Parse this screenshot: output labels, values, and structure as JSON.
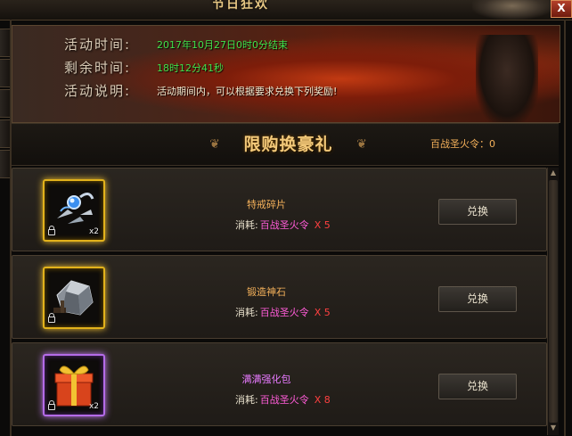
{
  "window": {
    "title": "节日狂欢",
    "close_label": "X"
  },
  "banner": {
    "rows": [
      {
        "label": "活动时间:",
        "value": "2017年10月27日0时0分结束"
      },
      {
        "label": "剩余时间:",
        "value": "18时12分41秒"
      },
      {
        "label": "活动说明:",
        "value": "活动期间内，可以根据要求兑换下列奖励!"
      }
    ]
  },
  "header": {
    "title": "限购换豪礼",
    "token_count": "百战圣火令：0"
  },
  "items": [
    {
      "name": "特戒碎片",
      "icon": "ring-fragment-icon",
      "quantity": "x2",
      "cost_label": "消耗:",
      "cost_token": "百战圣火令",
      "cost_amount": "X 5",
      "button": "兑换",
      "frame": "gold"
    },
    {
      "name": "锻造神石",
      "icon": "forge-stone-icon",
      "quantity": "",
      "cost_label": "消耗:",
      "cost_token": "百战圣火令",
      "cost_amount": "X 5",
      "button": "兑换",
      "frame": "gold"
    },
    {
      "name": "满满强化包",
      "icon": "gift-box-icon",
      "quantity": "x2",
      "cost_label": "消耗:",
      "cost_token": "百战圣火令",
      "cost_amount": "X 8",
      "button": "兑换",
      "frame": "purple"
    }
  ],
  "colors": {
    "gold_frame": "#e2b21b",
    "purple_frame": "#b46be8",
    "green_text": "#40e04a",
    "orange_text": "#f3b05a",
    "token_pink": "#ff5cd8",
    "amount_red": "#ff4040"
  }
}
